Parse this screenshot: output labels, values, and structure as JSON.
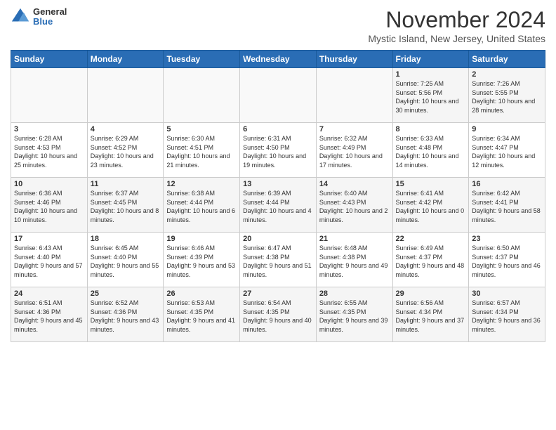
{
  "logo": {
    "general": "General",
    "blue": "Blue"
  },
  "header": {
    "month": "November 2024",
    "location": "Mystic Island, New Jersey, United States"
  },
  "weekdays": [
    "Sunday",
    "Monday",
    "Tuesday",
    "Wednesday",
    "Thursday",
    "Friday",
    "Saturday"
  ],
  "weeks": [
    [
      {
        "day": "",
        "info": ""
      },
      {
        "day": "",
        "info": ""
      },
      {
        "day": "",
        "info": ""
      },
      {
        "day": "",
        "info": ""
      },
      {
        "day": "",
        "info": ""
      },
      {
        "day": "1",
        "info": "Sunrise: 7:25 AM\nSunset: 5:56 PM\nDaylight: 10 hours and 30 minutes."
      },
      {
        "day": "2",
        "info": "Sunrise: 7:26 AM\nSunset: 5:55 PM\nDaylight: 10 hours and 28 minutes."
      }
    ],
    [
      {
        "day": "3",
        "info": "Sunrise: 6:28 AM\nSunset: 4:53 PM\nDaylight: 10 hours and 25 minutes."
      },
      {
        "day": "4",
        "info": "Sunrise: 6:29 AM\nSunset: 4:52 PM\nDaylight: 10 hours and 23 minutes."
      },
      {
        "day": "5",
        "info": "Sunrise: 6:30 AM\nSunset: 4:51 PM\nDaylight: 10 hours and 21 minutes."
      },
      {
        "day": "6",
        "info": "Sunrise: 6:31 AM\nSunset: 4:50 PM\nDaylight: 10 hours and 19 minutes."
      },
      {
        "day": "7",
        "info": "Sunrise: 6:32 AM\nSunset: 4:49 PM\nDaylight: 10 hours and 17 minutes."
      },
      {
        "day": "8",
        "info": "Sunrise: 6:33 AM\nSunset: 4:48 PM\nDaylight: 10 hours and 14 minutes."
      },
      {
        "day": "9",
        "info": "Sunrise: 6:34 AM\nSunset: 4:47 PM\nDaylight: 10 hours and 12 minutes."
      }
    ],
    [
      {
        "day": "10",
        "info": "Sunrise: 6:36 AM\nSunset: 4:46 PM\nDaylight: 10 hours and 10 minutes."
      },
      {
        "day": "11",
        "info": "Sunrise: 6:37 AM\nSunset: 4:45 PM\nDaylight: 10 hours and 8 minutes."
      },
      {
        "day": "12",
        "info": "Sunrise: 6:38 AM\nSunset: 4:44 PM\nDaylight: 10 hours and 6 minutes."
      },
      {
        "day": "13",
        "info": "Sunrise: 6:39 AM\nSunset: 4:44 PM\nDaylight: 10 hours and 4 minutes."
      },
      {
        "day": "14",
        "info": "Sunrise: 6:40 AM\nSunset: 4:43 PM\nDaylight: 10 hours and 2 minutes."
      },
      {
        "day": "15",
        "info": "Sunrise: 6:41 AM\nSunset: 4:42 PM\nDaylight: 10 hours and 0 minutes."
      },
      {
        "day": "16",
        "info": "Sunrise: 6:42 AM\nSunset: 4:41 PM\nDaylight: 9 hours and 58 minutes."
      }
    ],
    [
      {
        "day": "17",
        "info": "Sunrise: 6:43 AM\nSunset: 4:40 PM\nDaylight: 9 hours and 57 minutes."
      },
      {
        "day": "18",
        "info": "Sunrise: 6:45 AM\nSunset: 4:40 PM\nDaylight: 9 hours and 55 minutes."
      },
      {
        "day": "19",
        "info": "Sunrise: 6:46 AM\nSunset: 4:39 PM\nDaylight: 9 hours and 53 minutes."
      },
      {
        "day": "20",
        "info": "Sunrise: 6:47 AM\nSunset: 4:38 PM\nDaylight: 9 hours and 51 minutes."
      },
      {
        "day": "21",
        "info": "Sunrise: 6:48 AM\nSunset: 4:38 PM\nDaylight: 9 hours and 49 minutes."
      },
      {
        "day": "22",
        "info": "Sunrise: 6:49 AM\nSunset: 4:37 PM\nDaylight: 9 hours and 48 minutes."
      },
      {
        "day": "23",
        "info": "Sunrise: 6:50 AM\nSunset: 4:37 PM\nDaylight: 9 hours and 46 minutes."
      }
    ],
    [
      {
        "day": "24",
        "info": "Sunrise: 6:51 AM\nSunset: 4:36 PM\nDaylight: 9 hours and 45 minutes."
      },
      {
        "day": "25",
        "info": "Sunrise: 6:52 AM\nSunset: 4:36 PM\nDaylight: 9 hours and 43 minutes."
      },
      {
        "day": "26",
        "info": "Sunrise: 6:53 AM\nSunset: 4:35 PM\nDaylight: 9 hours and 41 minutes."
      },
      {
        "day": "27",
        "info": "Sunrise: 6:54 AM\nSunset: 4:35 PM\nDaylight: 9 hours and 40 minutes."
      },
      {
        "day": "28",
        "info": "Sunrise: 6:55 AM\nSunset: 4:35 PM\nDaylight: 9 hours and 39 minutes."
      },
      {
        "day": "29",
        "info": "Sunrise: 6:56 AM\nSunset: 4:34 PM\nDaylight: 9 hours and 37 minutes."
      },
      {
        "day": "30",
        "info": "Sunrise: 6:57 AM\nSunset: 4:34 PM\nDaylight: 9 hours and 36 minutes."
      }
    ]
  ]
}
